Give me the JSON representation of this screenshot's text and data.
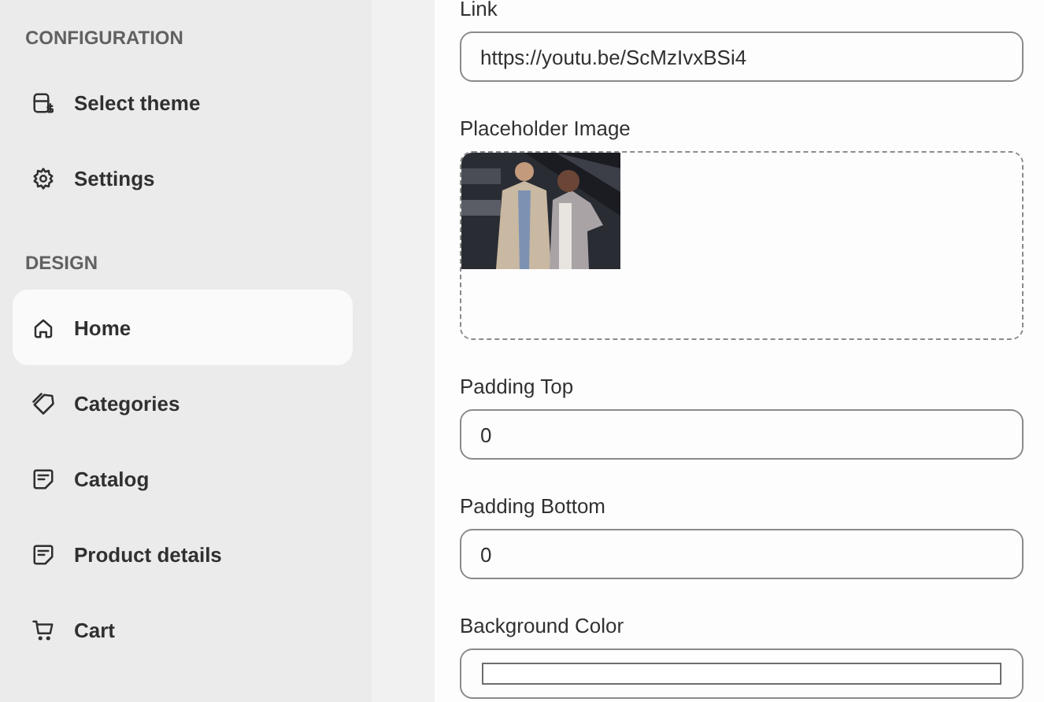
{
  "sidebar": {
    "sections": [
      {
        "title": "CONFIGURATION",
        "items": [
          {
            "label": "Select theme",
            "selected": false
          },
          {
            "label": "Settings",
            "selected": false
          }
        ]
      },
      {
        "title": "DESIGN",
        "items": [
          {
            "label": "Home",
            "selected": true
          },
          {
            "label": "Categories",
            "selected": false
          },
          {
            "label": "Catalog",
            "selected": false
          },
          {
            "label": "Product details",
            "selected": false
          },
          {
            "label": "Cart",
            "selected": false
          }
        ]
      }
    ]
  },
  "form": {
    "fields": [
      {
        "kind": "text",
        "label": "Link",
        "value": "https://youtu.be/ScMzIvxBSi4"
      },
      {
        "label": "Placeholder Image"
      },
      {
        "kind": "text",
        "label": "Padding Top",
        "value": "0"
      },
      {
        "kind": "text",
        "label": "Padding Bottom",
        "value": "0"
      },
      {
        "kind": "color",
        "label": "Background Color",
        "color": "#ffffff"
      }
    ]
  }
}
